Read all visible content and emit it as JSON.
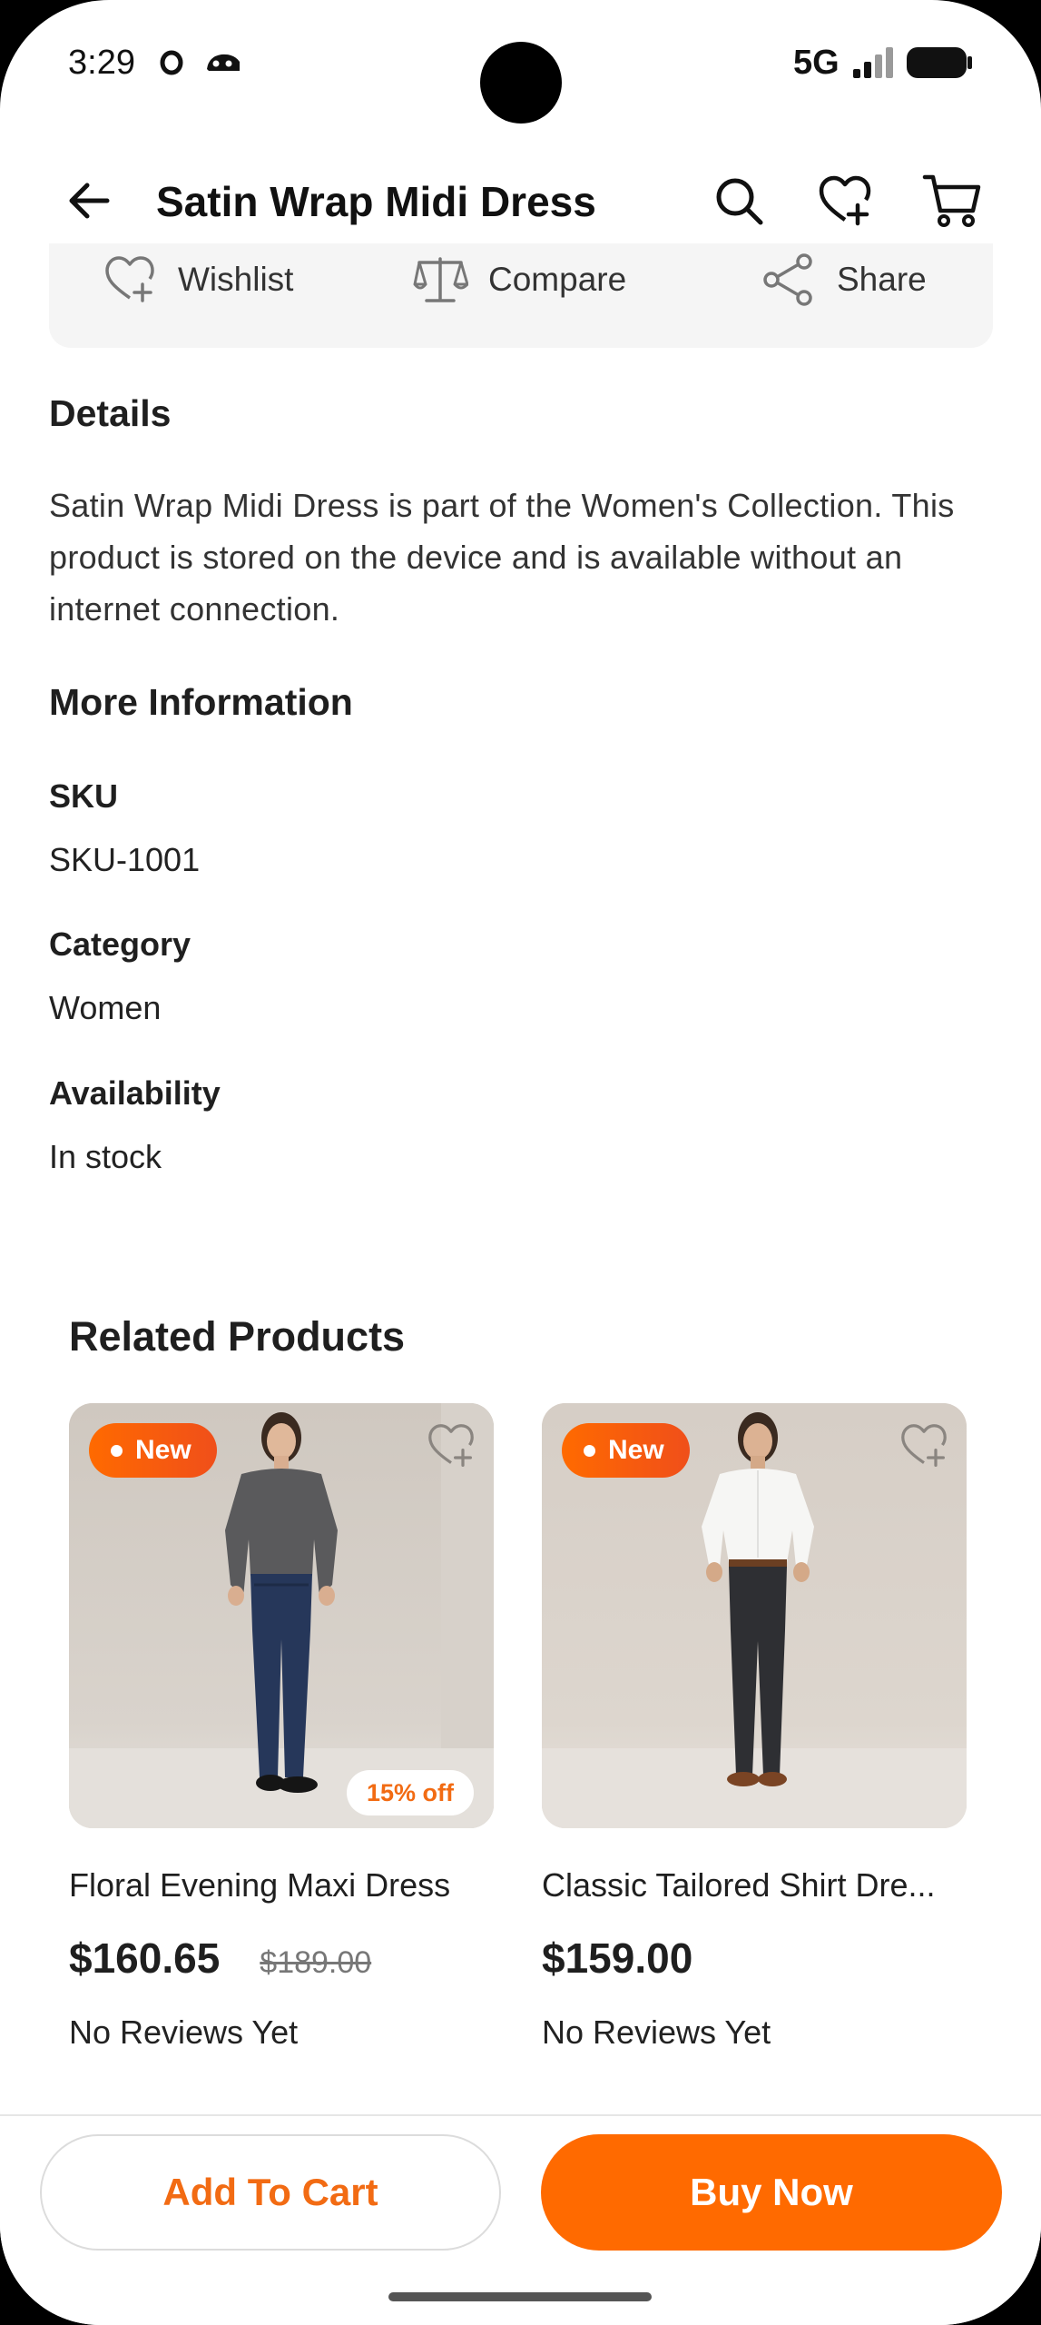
{
  "status_bar": {
    "time": "3:29",
    "network": "5G"
  },
  "header": {
    "title": "Satin Wrap Midi Dress",
    "icons": [
      "back-arrow-icon",
      "search-icon",
      "wishlist-heart-icon",
      "cart-icon"
    ]
  },
  "actions": [
    {
      "label": "Wishlist",
      "icon": "heart-plus-icon"
    },
    {
      "label": "Compare",
      "icon": "scale-icon"
    },
    {
      "label": "Share",
      "icon": "share-icon"
    }
  ],
  "details": {
    "title": "Details",
    "text": "Satin Wrap Midi Dress is part of the Women's Collection. This product is stored on the device and is available without an internet connection."
  },
  "more_info": {
    "title": "More Information",
    "rows": [
      {
        "label": "SKU",
        "value": "SKU-1001"
      },
      {
        "label": "Category",
        "value": "Women"
      },
      {
        "label": "Availability",
        "value": "In stock"
      }
    ]
  },
  "related": {
    "title": "Related Products",
    "products": [
      {
        "badge": "New",
        "discount": "15% off",
        "name": "Floral Evening Maxi Dress",
        "price": "$160.65",
        "old_price": "$189.00",
        "reviews": "No Reviews Yet"
      },
      {
        "badge": "New",
        "name": "Classic Tailored Shirt Dre...",
        "price": "$159.00",
        "reviews": "No Reviews Yet"
      }
    ]
  },
  "bottom": {
    "add_to_cart": "Add To Cart",
    "buy_now": "Buy Now"
  },
  "colors": {
    "accent": "#FF6A00",
    "accent_text": "#F26B13",
    "strip_bg": "#F5F5F5"
  }
}
